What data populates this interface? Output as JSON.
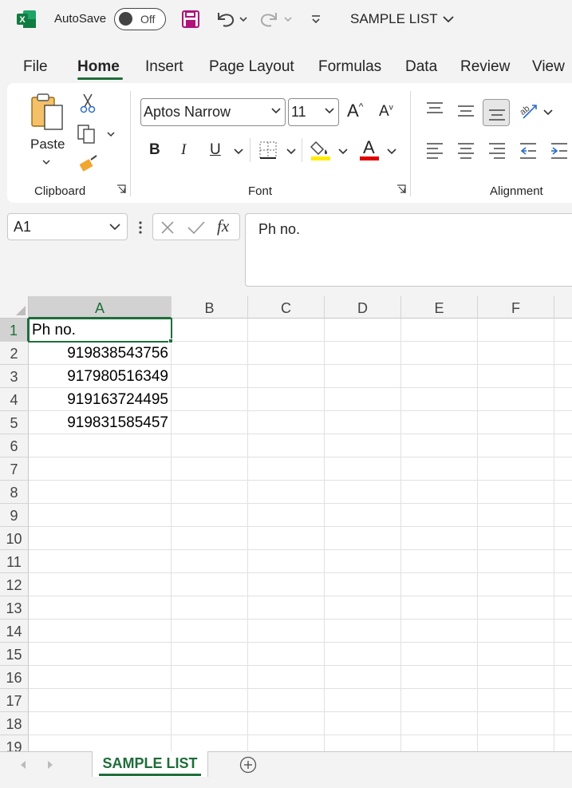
{
  "titlebar": {
    "app_icon": "excel-logo-icon",
    "autosave_label": "AutoSave",
    "autosave_state": "Off",
    "document_title": "SAMPLE LIST"
  },
  "tabs": [
    "File",
    "Home",
    "Insert",
    "Page Layout",
    "Formulas",
    "Data",
    "Review",
    "View"
  ],
  "active_tab": "Home",
  "ribbon": {
    "clipboard": {
      "paste_label": "Paste",
      "group_label": "Clipboard"
    },
    "font": {
      "font_name": "Aptos Narrow",
      "font_size": "11",
      "bold": "B",
      "italic": "I",
      "underline": "U",
      "font_color_glyph": "A",
      "grow_glyph": "A",
      "shrink_glyph": "A",
      "group_label": "Font",
      "highlight_color": "#ffeb00",
      "font_color": "#e00000"
    },
    "alignment": {
      "group_label": "Alignment"
    }
  },
  "formula_bar": {
    "name_box": "A1",
    "fx_label": "fx",
    "formula": "Ph no."
  },
  "grid": {
    "columns": [
      "A",
      "B",
      "C",
      "D",
      "E",
      "F"
    ],
    "rows": [
      "1",
      "2",
      "3",
      "4",
      "5",
      "6",
      "7",
      "8",
      "9",
      "10",
      "11",
      "12",
      "13",
      "14",
      "15",
      "16",
      "17",
      "18",
      "19"
    ],
    "cells": {
      "A1": "Ph no.",
      "A2": "919838543756",
      "A3": "917980516349",
      "A4": "919163724495",
      "A5": "919831585457"
    },
    "selected_cell": "A1"
  },
  "sheets": [
    "SAMPLE LIST"
  ],
  "active_sheet": "SAMPLE LIST",
  "colors": {
    "accent": "#1e6d3a",
    "excel_green": "#107c41"
  }
}
